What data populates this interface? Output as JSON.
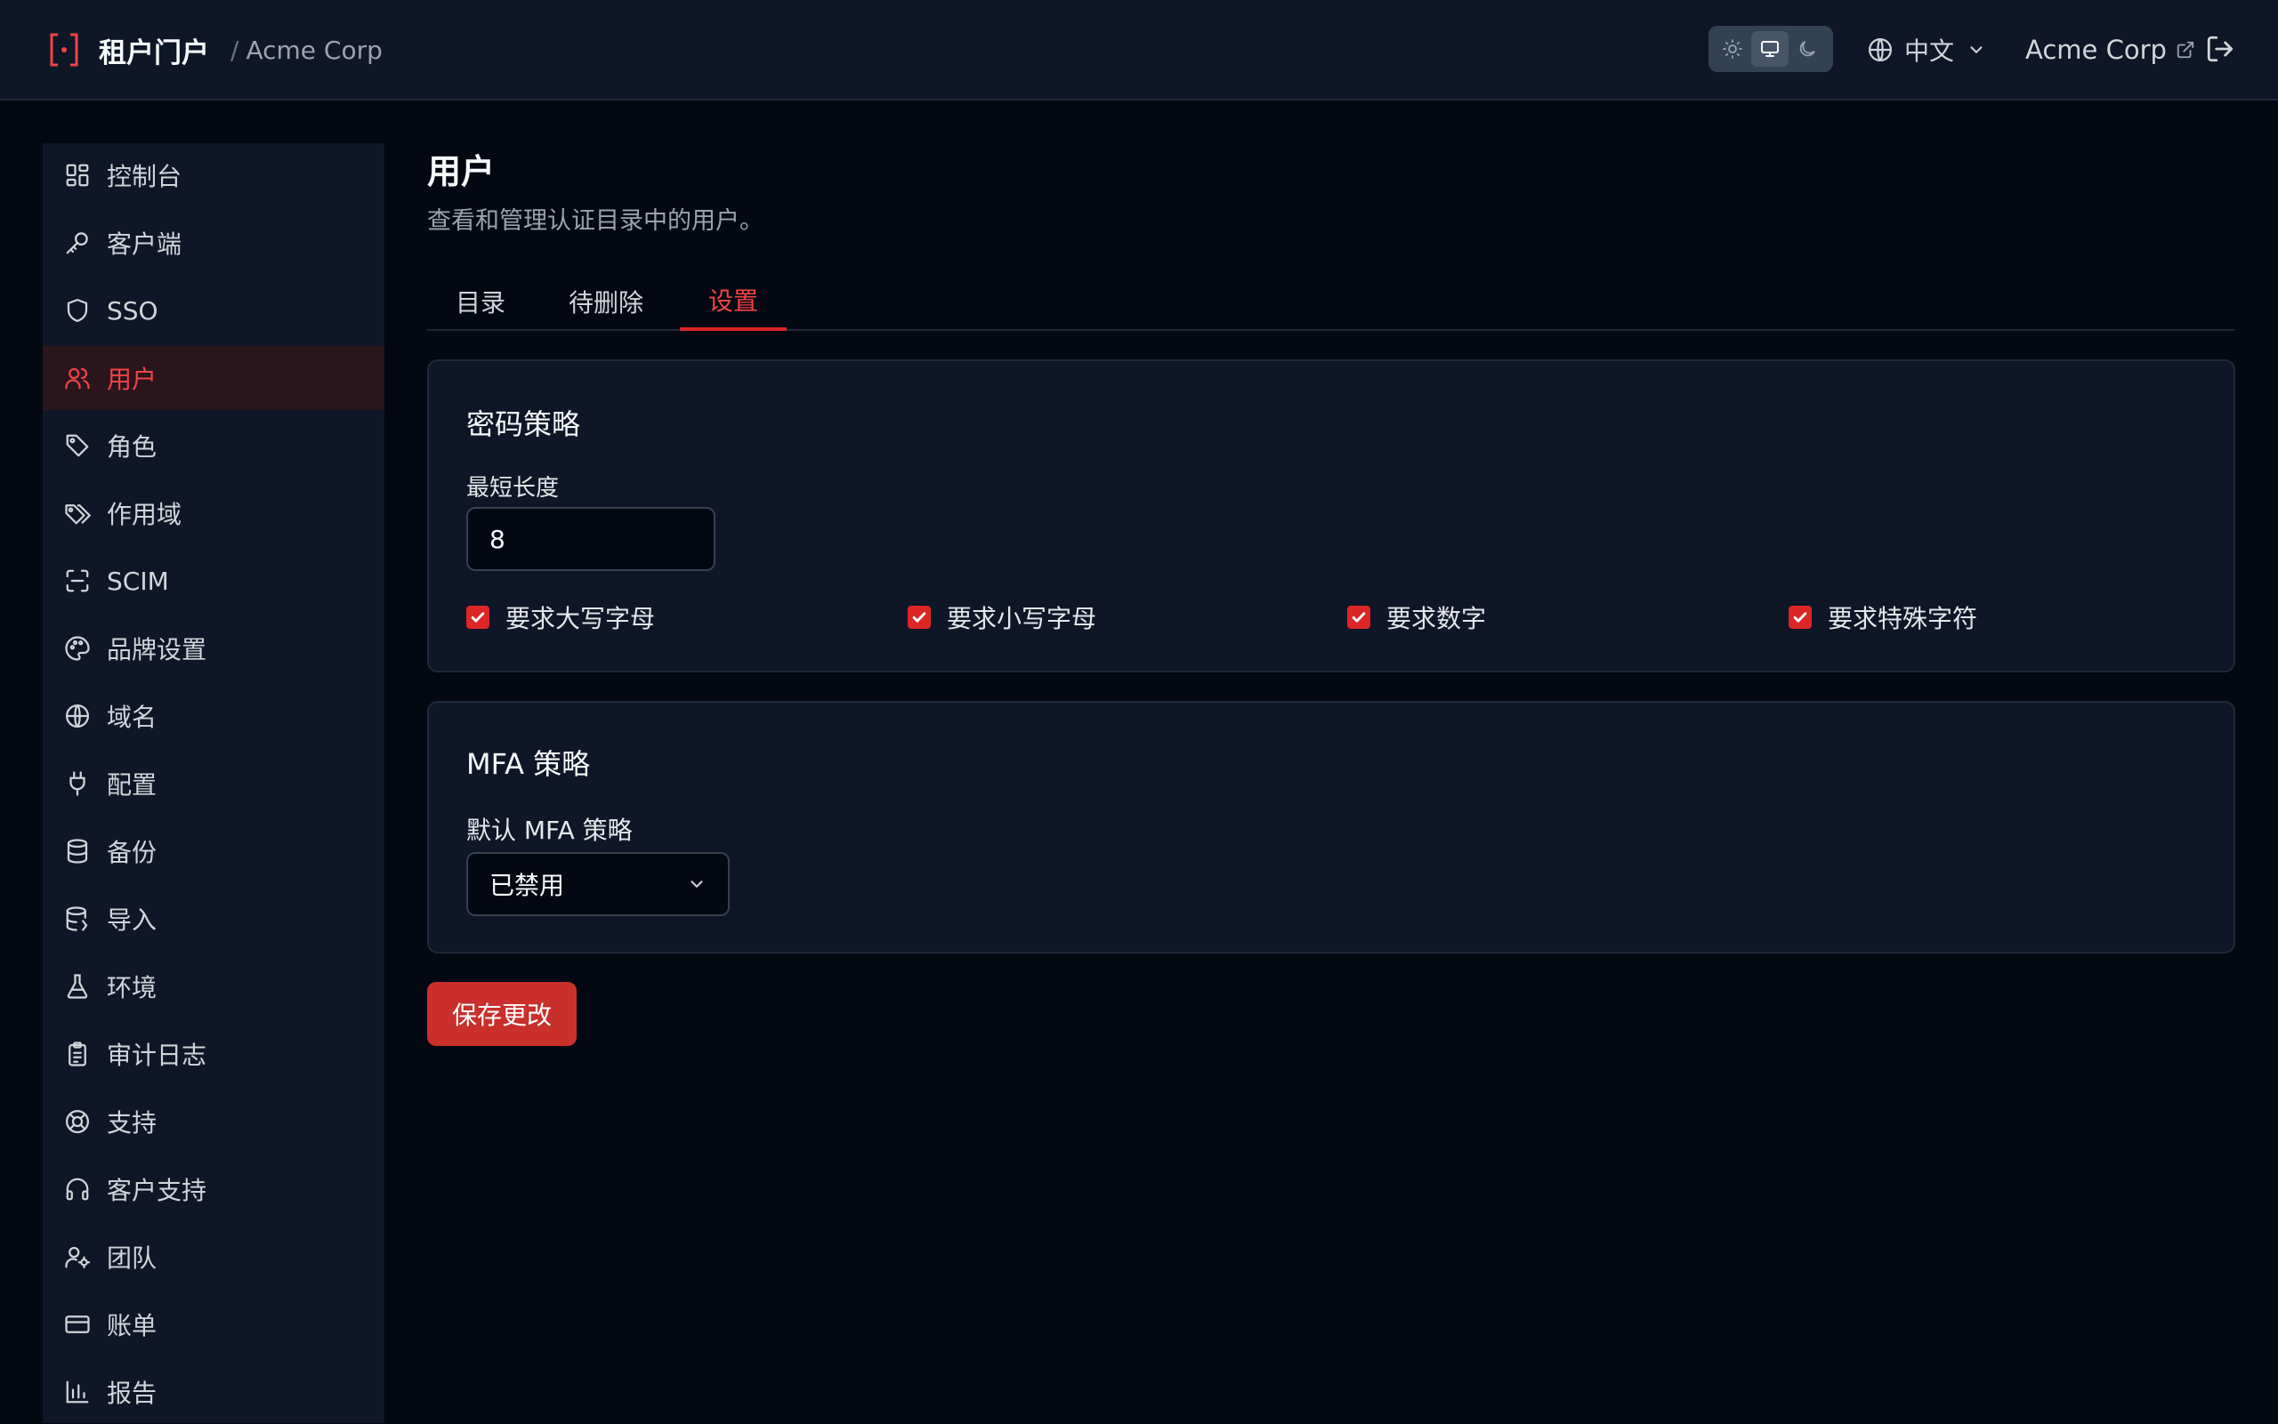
{
  "header": {
    "app_name": "租户门户",
    "separator": "/",
    "tenant_name": "Acme Corp",
    "language": "中文",
    "org_link": "Acme Corp",
    "theme_options": [
      "light",
      "system",
      "dark"
    ],
    "theme_selected": "system"
  },
  "sidebar": {
    "items": [
      {
        "label": "控制台",
        "icon": "dashboard-icon"
      },
      {
        "label": "客户端",
        "icon": "key-icon"
      },
      {
        "label": "SSO",
        "icon": "shield-icon"
      },
      {
        "label": "用户",
        "icon": "users-icon",
        "active": true
      },
      {
        "label": "角色",
        "icon": "tag-icon"
      },
      {
        "label": "作用域",
        "icon": "tags-icon"
      },
      {
        "label": "SCIM",
        "icon": "scan-icon"
      },
      {
        "label": "品牌设置",
        "icon": "palette-icon"
      },
      {
        "label": "域名",
        "icon": "globe-icon"
      },
      {
        "label": "配置",
        "icon": "plug-icon"
      },
      {
        "label": "备份",
        "icon": "database-icon"
      },
      {
        "label": "导入",
        "icon": "database-import-icon"
      },
      {
        "label": "环境",
        "icon": "flask-icon"
      },
      {
        "label": "审计日志",
        "icon": "clipboard-icon"
      },
      {
        "label": "支持",
        "icon": "life-buoy-icon"
      },
      {
        "label": "客户支持",
        "icon": "headphones-icon"
      },
      {
        "label": "团队",
        "icon": "user-cog-icon"
      },
      {
        "label": "账单",
        "icon": "credit-card-icon"
      },
      {
        "label": "报告",
        "icon": "bar-chart-icon"
      }
    ]
  },
  "main": {
    "title": "用户",
    "subtitle": "查看和管理认证目录中的用户。",
    "tabs": [
      {
        "label": "目录"
      },
      {
        "label": "待删除"
      },
      {
        "label": "设置",
        "active": true
      }
    ],
    "password_policy": {
      "title": "密码策略",
      "min_length_label": "最短长度",
      "min_length_value": "8",
      "checks": [
        {
          "label": "要求大写字母",
          "checked": true
        },
        {
          "label": "要求小写字母",
          "checked": true
        },
        {
          "label": "要求数字",
          "checked": true
        },
        {
          "label": "要求特殊字符",
          "checked": true
        }
      ]
    },
    "mfa_policy": {
      "title": "MFA 策略",
      "default_label": "默认 MFA 策略",
      "default_value": "已禁用"
    },
    "save_label": "保存更改"
  },
  "colors": {
    "accent": "#dc2626",
    "background": "#040812",
    "panel": "#0e1627"
  }
}
